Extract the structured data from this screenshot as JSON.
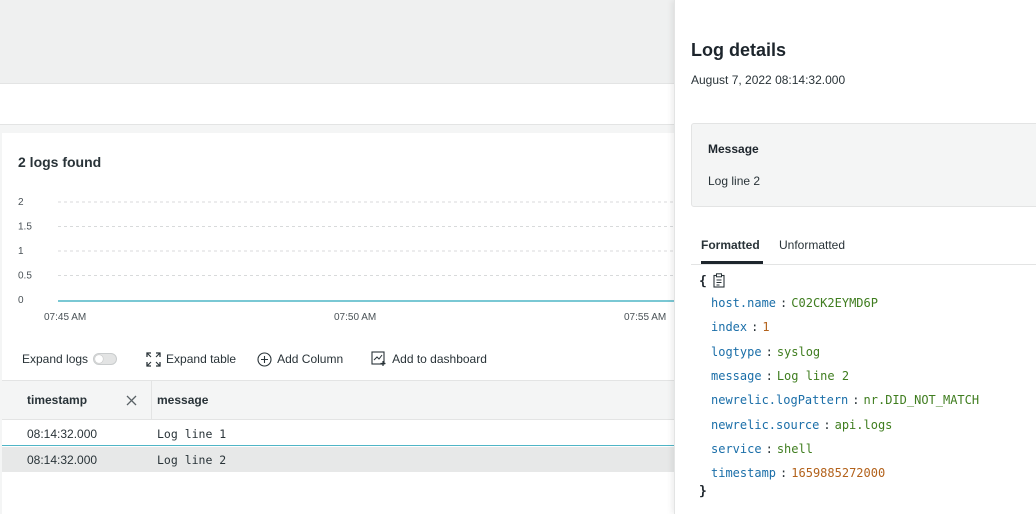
{
  "summary": {
    "count_label": "2 logs found"
  },
  "chart_data": {
    "type": "line",
    "y_ticks": [
      "2",
      "1.5",
      "1",
      "0.5",
      "0"
    ],
    "x_ticks": [
      "07:45 AM",
      "07:50 AM",
      "07:55 AM"
    ],
    "ylim": [
      0,
      2
    ],
    "grid": true,
    "series": [
      {
        "values": [
          0,
          0,
          0
        ]
      }
    ],
    "line_color": "#4fb5c6"
  },
  "toolbar": {
    "expand_logs": "Expand logs",
    "expand_table": "Expand table",
    "add_column": "Add Column",
    "add_dashboard": "Add to dashboard"
  },
  "table": {
    "columns": [
      "timestamp",
      "message"
    ],
    "rows": [
      {
        "timestamp": "08:14:32.000",
        "message": "Log line 1"
      },
      {
        "timestamp": "08:14:32.000",
        "message": "Log line 2"
      }
    ]
  },
  "panel": {
    "title": "Log details",
    "date": "August 7, 2022 08:14:32.000",
    "message_label": "Message",
    "message_value": "Log line 2",
    "tabs": [
      "Formatted",
      "Unformatted"
    ],
    "json": [
      {
        "key": "host.name",
        "value": "C02CK2EYMD6P",
        "kind": "string"
      },
      {
        "key": "index",
        "value": "1",
        "kind": "number"
      },
      {
        "key": "logtype",
        "value": "syslog",
        "kind": "string"
      },
      {
        "key": "message",
        "value": "Log line 2",
        "kind": "string"
      },
      {
        "key": "newrelic.logPattern",
        "value": "nr.DID_NOT_MATCH",
        "kind": "string"
      },
      {
        "key": "newrelic.source",
        "value": "api.logs",
        "kind": "string"
      },
      {
        "key": "service",
        "value": "shell",
        "kind": "string"
      },
      {
        "key": "timestamp",
        "value": "1659885272000",
        "kind": "number"
      }
    ],
    "brace_open": "{",
    "brace_close": "}"
  }
}
